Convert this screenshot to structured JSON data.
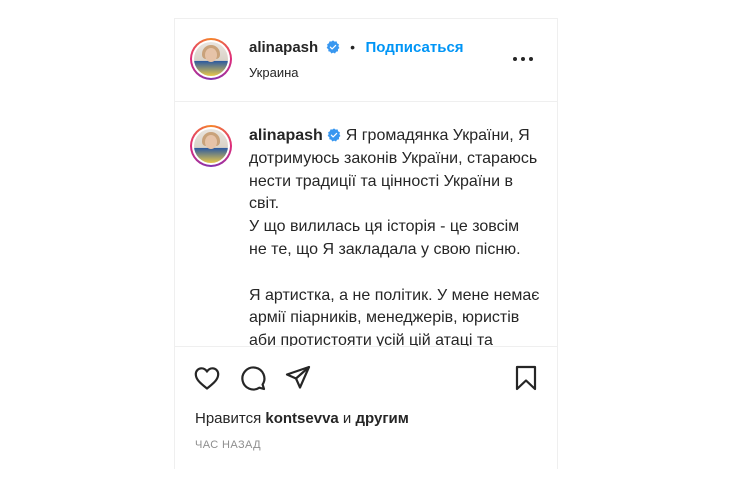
{
  "header": {
    "username": "alinapash",
    "follow_label": "Подписаться",
    "location": "Украина",
    "separator": "•"
  },
  "caption": {
    "username": "alinapash",
    "text": "Я громадянка України, Я дотримуюсь законів України, стараюсь нести традиції та цінності України в світ.\nУ що вилилась ця історія - це зовсім не те, що Я закладала у свою пісню.\n\nЯ артистка, а не політик. У мене немає армії піарників, менеджерів, юристів аби протистояти усій цій атаці та натиску, адамам моїх"
  },
  "likes": {
    "prefix": "Нравится",
    "user": "kontsevva",
    "middle": "и",
    "suffix": "другим"
  },
  "timestamp": "ЧАС НАЗАД",
  "colors": {
    "accent": "#0095f6",
    "verified": "#3897f0",
    "text": "#262626",
    "muted": "#8e8e8e"
  },
  "icons": [
    "heart-icon",
    "comment-icon",
    "share-icon",
    "bookmark-icon",
    "more-icon",
    "verified-icon"
  ]
}
